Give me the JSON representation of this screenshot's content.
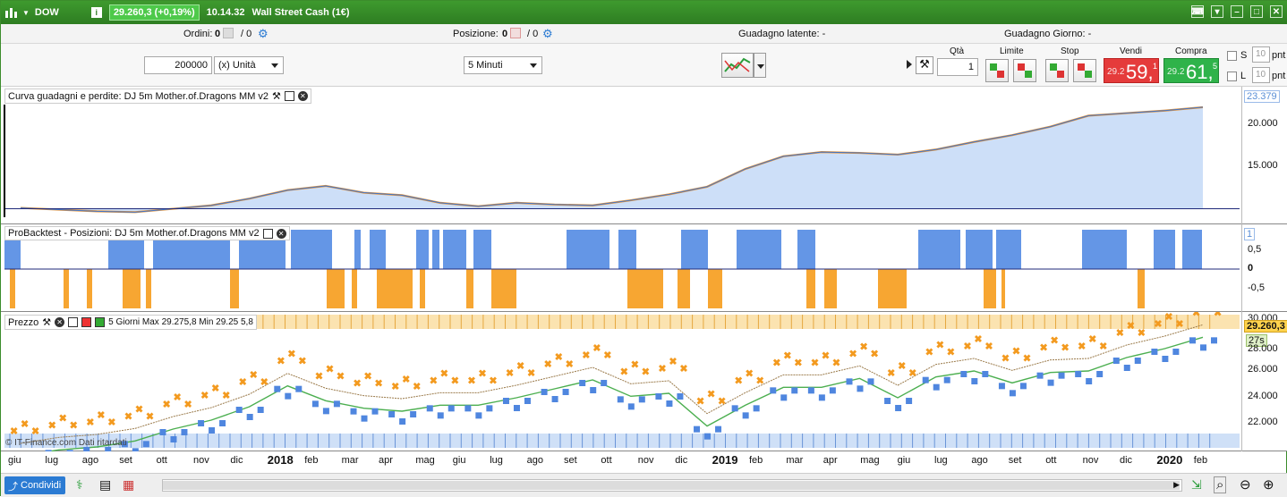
{
  "titlebar": {
    "symbol": "DOW",
    "info_icon": "info-icon",
    "price": "29.260,3 (+0,19%)",
    "time": "10.14.32",
    "instrument": "Wall Street Cash (1€)"
  },
  "orders_bar": {
    "ordini_label": "Ordini:",
    "ordini_value": "0",
    "ordini_total": "/ 0",
    "posizione_label": "Posizione:",
    "posizione_value": "0",
    "posizione_total": "/ 0",
    "guadagno_latente": "Guadagno latente: -",
    "guadagno_giorno": "Guadagno Giorno: -"
  },
  "controls": {
    "capital": "200000",
    "unit_select": "(x) Unità",
    "timeframe_select": "5 Minuti"
  },
  "trade_panel": {
    "qta_label": "Qtà",
    "qta_value": "1",
    "limite_label": "Limite",
    "stop_label": "Stop",
    "vendi_label": "Vendi",
    "compra_label": "Compra",
    "vendi_small": "29.2",
    "vendi_big": "59,",
    "vendi_sup": "1",
    "compra_small": "29.2",
    "compra_big": "61,",
    "compra_sup": "5",
    "s_label": "S",
    "l_label": "L",
    "s_pnt": "10",
    "l_pnt": "10",
    "pnt": "pnt"
  },
  "panes": {
    "equity_title": "Curva guadagni e perdite: DJ 5m Mother.of.Dragons MM v2",
    "equity_last": "23.379",
    "equity_ticks": [
      "20.000",
      "15.000"
    ],
    "positions_title": "ProBacktest - Posizioni: DJ 5m Mother.of.Dragons MM v2",
    "positions_ticks": [
      "1",
      "0,5",
      "0",
      "-0,5"
    ],
    "price_title": "Prezzo",
    "price_info": "5 Giorni Max 29.275,8 Min 29.25 5,8",
    "price_last": "29.260,3",
    "price_countdown": "27s",
    "price_ticks": [
      "30.000",
      "28.000",
      "26.000",
      "24.000",
      "22.000"
    ],
    "watermark": "© IT-Finance.com Dati ritardati"
  },
  "xaxis": {
    "months": [
      {
        "label": "giu",
        "bold": false
      },
      {
        "label": "lug",
        "bold": false
      },
      {
        "label": "ago",
        "bold": false
      },
      {
        "label": "set",
        "bold": false
      },
      {
        "label": "ott",
        "bold": false
      },
      {
        "label": "nov",
        "bold": false
      },
      {
        "label": "dic",
        "bold": false
      },
      {
        "label": "2018",
        "bold": true
      },
      {
        "label": "feb",
        "bold": false
      },
      {
        "label": "mar",
        "bold": false
      },
      {
        "label": "apr",
        "bold": false
      },
      {
        "label": "mag",
        "bold": false
      },
      {
        "label": "giu",
        "bold": false
      },
      {
        "label": "lug",
        "bold": false
      },
      {
        "label": "ago",
        "bold": false
      },
      {
        "label": "set",
        "bold": false
      },
      {
        "label": "ott",
        "bold": false
      },
      {
        "label": "nov",
        "bold": false
      },
      {
        "label": "dic",
        "bold": false
      },
      {
        "label": "2019",
        "bold": true
      },
      {
        "label": "feb",
        "bold": false
      },
      {
        "label": "mar",
        "bold": false
      },
      {
        "label": "apr",
        "bold": false
      },
      {
        "label": "mag",
        "bold": false
      },
      {
        "label": "giu",
        "bold": false
      },
      {
        "label": "lug",
        "bold": false
      },
      {
        "label": "ago",
        "bold": false
      },
      {
        "label": "set",
        "bold": false
      },
      {
        "label": "ott",
        "bold": false
      },
      {
        "label": "nov",
        "bold": false
      },
      {
        "label": "dic",
        "bold": false
      },
      {
        "label": "2020",
        "bold": true
      },
      {
        "label": "feb",
        "bold": false
      }
    ]
  },
  "bottombar": {
    "share_label": "Condividi"
  },
  "chart_data": [
    {
      "type": "area",
      "title": "Curva guadagni e perdite: DJ 5m Mother.of.Dragons MM v2",
      "x": [
        "2017-06",
        "2017-07",
        "2017-08",
        "2017-09",
        "2017-10",
        "2017-11",
        "2017-12",
        "2018-01",
        "2018-02",
        "2018-03",
        "2018-04",
        "2018-05",
        "2018-06",
        "2018-07",
        "2018-08",
        "2018-09",
        "2018-10",
        "2018-11",
        "2018-12",
        "2019-01",
        "2019-02",
        "2019-03",
        "2019-04",
        "2019-05",
        "2019-06",
        "2019-07",
        "2019-08",
        "2019-09",
        "2019-10",
        "2019-11",
        "2019-12",
        "2020-01"
      ],
      "series": [
        {
          "values": [
            10100,
            9900,
            9700,
            9600,
            10000,
            10400,
            11200,
            12200,
            12700,
            11900,
            11600,
            10700,
            10300,
            10700,
            10500,
            10400,
            11000,
            11700,
            12600,
            14700,
            16200,
            16700,
            16600,
            16400,
            17000,
            17900,
            18700,
            19700,
            21000,
            21300,
            21600,
            22000
          ]
        }
      ],
      "ylim": [
        9000,
        24000
      ],
      "last_value": 23379
    },
    {
      "type": "line",
      "title": "Prezzo",
      "x": [
        "2017-06",
        "2017-07",
        "2017-08",
        "2017-09",
        "2017-10",
        "2017-11",
        "2017-12",
        "2018-01",
        "2018-02",
        "2018-03",
        "2018-04",
        "2018-05",
        "2018-06",
        "2018-07",
        "2018-08",
        "2018-09",
        "2018-10",
        "2018-11",
        "2018-12",
        "2019-01",
        "2019-02",
        "2019-03",
        "2019-04",
        "2019-05",
        "2019-06",
        "2019-07",
        "2019-08",
        "2019-09",
        "2019-10",
        "2019-11",
        "2019-12",
        "2020-01"
      ],
      "series": [
        {
          "values": [
            21300,
            21700,
            21900,
            22300,
            23100,
            23700,
            24600,
            26000,
            25000,
            24500,
            24300,
            24700,
            24700,
            25200,
            25800,
            26400,
            25300,
            25500,
            23300,
            24700,
            25900,
            25900,
            26500,
            25200,
            26600,
            27000,
            26200,
            26900,
            27000,
            27900,
            28500,
            29260
          ]
        }
      ],
      "ylim": [
        21000,
        30000
      ],
      "last_value": 29260.3
    }
  ]
}
